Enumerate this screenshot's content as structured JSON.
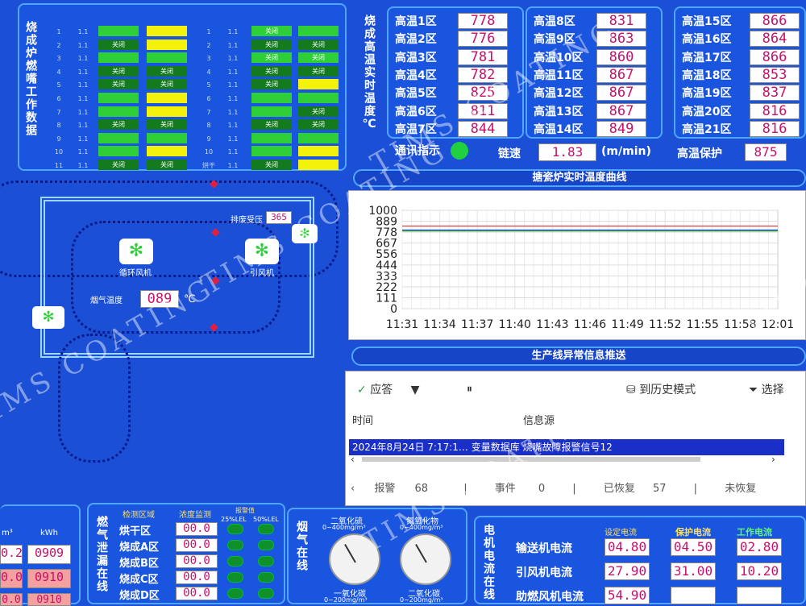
{
  "burner": {
    "title": "烧成炉燃嘴工作数据",
    "rows": [
      {
        "no": "1",
        "val": "1.1",
        "b1": "g",
        "b2": "y",
        "no2": "1",
        "val2": "1.1",
        "b3": "g",
        "b4": "g",
        "t1": "",
        "t2": "",
        "t3": "关闭",
        "t4": ""
      },
      {
        "no": "2",
        "val": "1.1",
        "b1": "dg",
        "b2": "y",
        "no2": "2",
        "val2": "1.1",
        "b3": "dg",
        "b4": "dg",
        "t1": "关闭",
        "t2": "",
        "t3": "关闭",
        "t4": "关闭"
      },
      {
        "no": "3",
        "val": "1.1",
        "b1": "g",
        "b2": "g",
        "no2": "3",
        "val2": "1.1",
        "b3": "g",
        "b4": "g",
        "t1": "",
        "t2": "",
        "t3": "关闭",
        "t4": "关闭"
      },
      {
        "no": "4",
        "val": "1.1",
        "b1": "dg",
        "b2": "dg",
        "no2": "4",
        "val2": "1.1",
        "b3": "dg",
        "b4": "dg",
        "t1": "关闭",
        "t2": "关闭",
        "t3": "关闭",
        "t4": "关闭"
      },
      {
        "no": "5",
        "val": "1.1",
        "b1": "dg",
        "b2": "dg",
        "no2": "5",
        "val2": "1.1",
        "b3": "dg",
        "b4": "y",
        "t1": "关闭",
        "t2": "关闭",
        "t3": "关闭",
        "t4": ""
      },
      {
        "no": "6",
        "val": "1.1",
        "b1": "g",
        "b2": "y",
        "no2": "6",
        "val2": "1.1",
        "b3": "g",
        "b4": "g",
        "t1": "",
        "t2": "",
        "t3": "",
        "t4": ""
      },
      {
        "no": "7",
        "val": "1.1",
        "b1": "g",
        "b2": "y",
        "no2": "7",
        "val2": "1.1",
        "b3": "g",
        "b4": "dg",
        "t1": "",
        "t2": "",
        "t3": "",
        "t4": "关闭"
      },
      {
        "no": "8",
        "val": "1.1",
        "b1": "dg",
        "b2": "dg",
        "no2": "8",
        "val2": "1.1",
        "b3": "dg",
        "b4": "dg",
        "t1": "关闭",
        "t2": "关闭",
        "t3": "关闭",
        "t4": "关闭"
      },
      {
        "no": "9",
        "val": "1.1",
        "b1": "g",
        "b2": "g",
        "no2": "9",
        "val2": "1.1",
        "b3": "g",
        "b4": "g",
        "t1": "",
        "t2": "",
        "t3": "",
        "t4": ""
      },
      {
        "no": "10",
        "val": "1.1",
        "b1": "g",
        "b2": "y",
        "no2": "10",
        "val2": "1.1",
        "b3": "g",
        "b4": "y",
        "t1": "",
        "t2": "",
        "t3": "",
        "t4": ""
      },
      {
        "no": "11",
        "val": "1.1",
        "b1": "dg",
        "b2": "dg",
        "no2": "烘干",
        "val2": "1.1",
        "b3": "dg",
        "b4": "y",
        "t1": "关闭",
        "t2": "关闭",
        "t3": "关闭",
        "t4": ""
      }
    ]
  },
  "temps": {
    "title": "烧成高温实时温度℃",
    "zones": [
      {
        "label": "高温1区",
        "value": "778"
      },
      {
        "label": "高温2区",
        "value": "776"
      },
      {
        "label": "高温3区",
        "value": "781"
      },
      {
        "label": "高温4区",
        "value": "782"
      },
      {
        "label": "高温5区",
        "value": "825"
      },
      {
        "label": "高温6区",
        "value": "811"
      },
      {
        "label": "高温7区",
        "value": "844"
      },
      {
        "label": "高温8区",
        "value": "831"
      },
      {
        "label": "高温9区",
        "value": "863"
      },
      {
        "label": "高温10区",
        "value": "860"
      },
      {
        "label": "高温11区",
        "value": "867"
      },
      {
        "label": "高温12区",
        "value": "867"
      },
      {
        "label": "高温13区",
        "value": "867"
      },
      {
        "label": "高温14区",
        "value": "849"
      },
      {
        "label": "高温15区",
        "value": "866"
      },
      {
        "label": "高温16区",
        "value": "864"
      },
      {
        "label": "高温17区",
        "value": "866"
      },
      {
        "label": "高温18区",
        "value": "853"
      },
      {
        "label": "高温19区",
        "value": "837"
      },
      {
        "label": "高温20区",
        "value": "816"
      },
      {
        "label": "高温21区",
        "value": "816"
      }
    ],
    "comm_label": "通讯指示",
    "speed_label": "链速",
    "speed_value": "1.83",
    "speed_unit": "(m/min)",
    "protect_label": "高温保护",
    "protect_value": "875"
  },
  "flow": {
    "exhaust_label": "排废受压",
    "exhaust_value": "365",
    "fan1_label": "循环风机",
    "fan2_label": "引风机",
    "temp_label": "烟气温度",
    "temp_value": "089",
    "temp_unit": "℃"
  },
  "curve": {
    "title": "搪瓷炉实时温度曲线"
  },
  "chart_data": {
    "type": "line",
    "title": "",
    "ylim": [
      0,
      1000
    ],
    "yticks": [
      "1000",
      "889",
      "778",
      "667",
      "556",
      "444",
      "333",
      "222",
      "111",
      "0"
    ],
    "xticks": [
      "11:31",
      "11:34",
      "11:37",
      "11:40",
      "11:43",
      "11:46",
      "11:49",
      "11:52",
      "11:55",
      "11:58",
      "12:01"
    ],
    "series": [
      {
        "color": "#d04040",
        "values": [
          840,
          840,
          840,
          840,
          840,
          840,
          840,
          840,
          840,
          840,
          840
        ]
      },
      {
        "color": "#3060d0",
        "values": [
          800,
          800,
          800,
          800,
          800,
          800,
          800,
          800,
          800,
          800,
          800
        ]
      },
      {
        "color": "#30a040",
        "values": [
          790,
          790,
          790,
          790,
          790,
          790,
          790,
          790,
          790,
          790,
          790
        ]
      }
    ]
  },
  "alarm": {
    "title": "生产线异常信息推送",
    "ack_label": "应答",
    "history_label": "到历史模式",
    "select_label": "选择",
    "col_time": "时间",
    "col_source": "信息源",
    "row_text": "2024年8月24日 7:17:1…   变量数据库 烧嘴故障报警信号12",
    "status_alarm_label": "报警",
    "status_alarm_value": "68",
    "status_event_label": "事件",
    "status_event_value": "0",
    "status_recovered_label": "已恢复",
    "status_recovered_value": "57",
    "status_unrecovered_label": "未恢复"
  },
  "gas_leak": {
    "title": "燃气泄漏在线",
    "col_area": "检测区域",
    "col_conc": "浓度监测",
    "col_alarm": "报警值",
    "lel25": "25%LEL",
    "lel50": "50%LEL",
    "rows": [
      {
        "area": "烘干区",
        "value": "00.0"
      },
      {
        "area": "烧成A区",
        "value": "00.0"
      },
      {
        "area": "烧成B区",
        "value": "00.0"
      },
      {
        "area": "烧成C区",
        "value": "00.0"
      },
      {
        "area": "烧成D区",
        "value": "00.0"
      }
    ]
  },
  "smoke": {
    "title": "烟气在线",
    "g1": "二氧化硫",
    "g1_range": "0~400mg/m³",
    "g2": "氮氧化物",
    "g2_range": "0~400mg/m³",
    "g3": "一氧化碳",
    "g3_range": "0~200mg/m³",
    "g4": "二氧化碳",
    "g4_range": "0~200mg/m³"
  },
  "motor": {
    "title": "电机电流在线",
    "col_setting": "设定电流",
    "col_protect": "保护电流",
    "col_work": "工作电流",
    "rows": [
      {
        "label": "输送机电流",
        "setting": "04.80",
        "protect": "04.50",
        "work": "02.80"
      },
      {
        "label": "引风机电流",
        "setting": "27.90",
        "protect": "31.00",
        "work": "10.20"
      },
      {
        "label": "助燃风机电流",
        "setting": "54.90",
        "protect": "",
        "work": ""
      }
    ]
  },
  "power": {
    "unit1": "m³",
    "unit2": "kWh",
    "v1": "0.2",
    "v2": "0909",
    "v3": "0.0",
    "v4": "0910",
    "v5": "0.0",
    "v6": "0910"
  },
  "watermark": "TIMS COATING"
}
